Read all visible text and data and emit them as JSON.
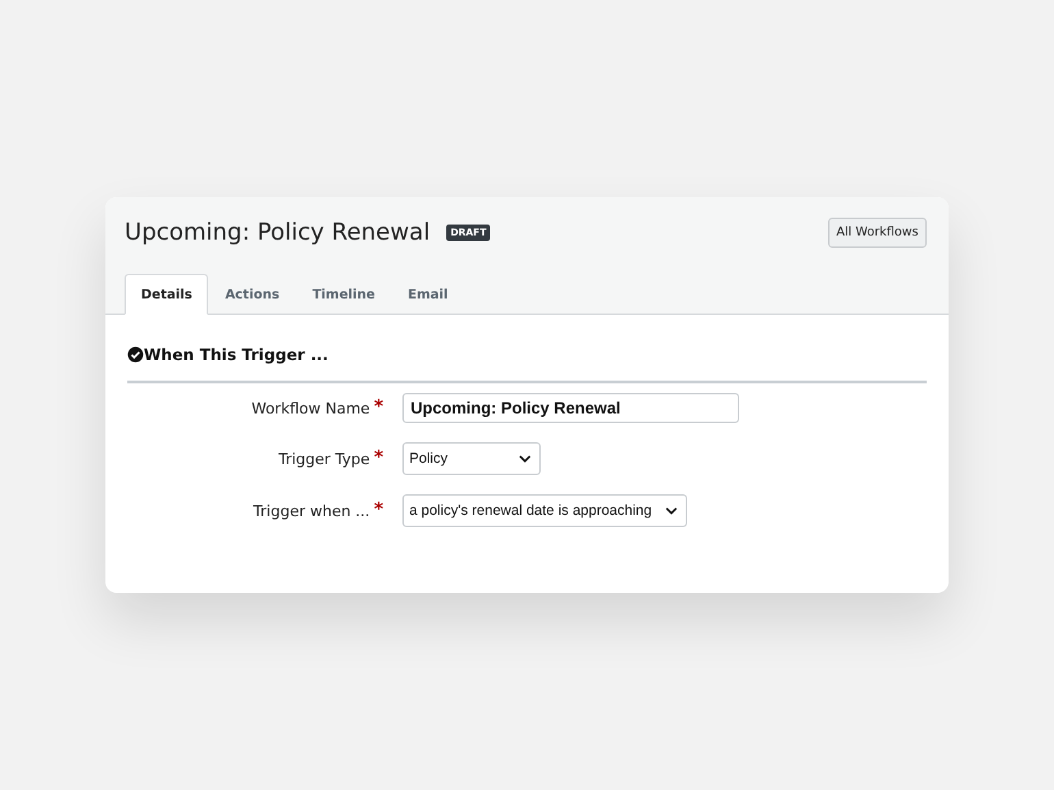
{
  "header": {
    "title": "Upcoming: Policy Renewal",
    "badge": "DRAFT",
    "button": "All Workflows"
  },
  "tabs": [
    {
      "label": "Details",
      "selected": true
    },
    {
      "label": "Actions",
      "selected": false
    },
    {
      "label": "Timeline",
      "selected": false
    },
    {
      "label": "Email",
      "selected": false
    }
  ],
  "section": {
    "title": "When This Trigger ..."
  },
  "fields": [
    {
      "label": "Workflow Name",
      "required_mark": "*",
      "kind": "text",
      "value": "Upcoming: Policy Renewal"
    },
    {
      "label": "Trigger Type",
      "required_mark": "*",
      "kind": "select",
      "value": "Policy"
    },
    {
      "label": "Trigger when ...",
      "required_mark": "*",
      "kind": "select",
      "value": "a policy's renewal date is approaching"
    }
  ]
}
